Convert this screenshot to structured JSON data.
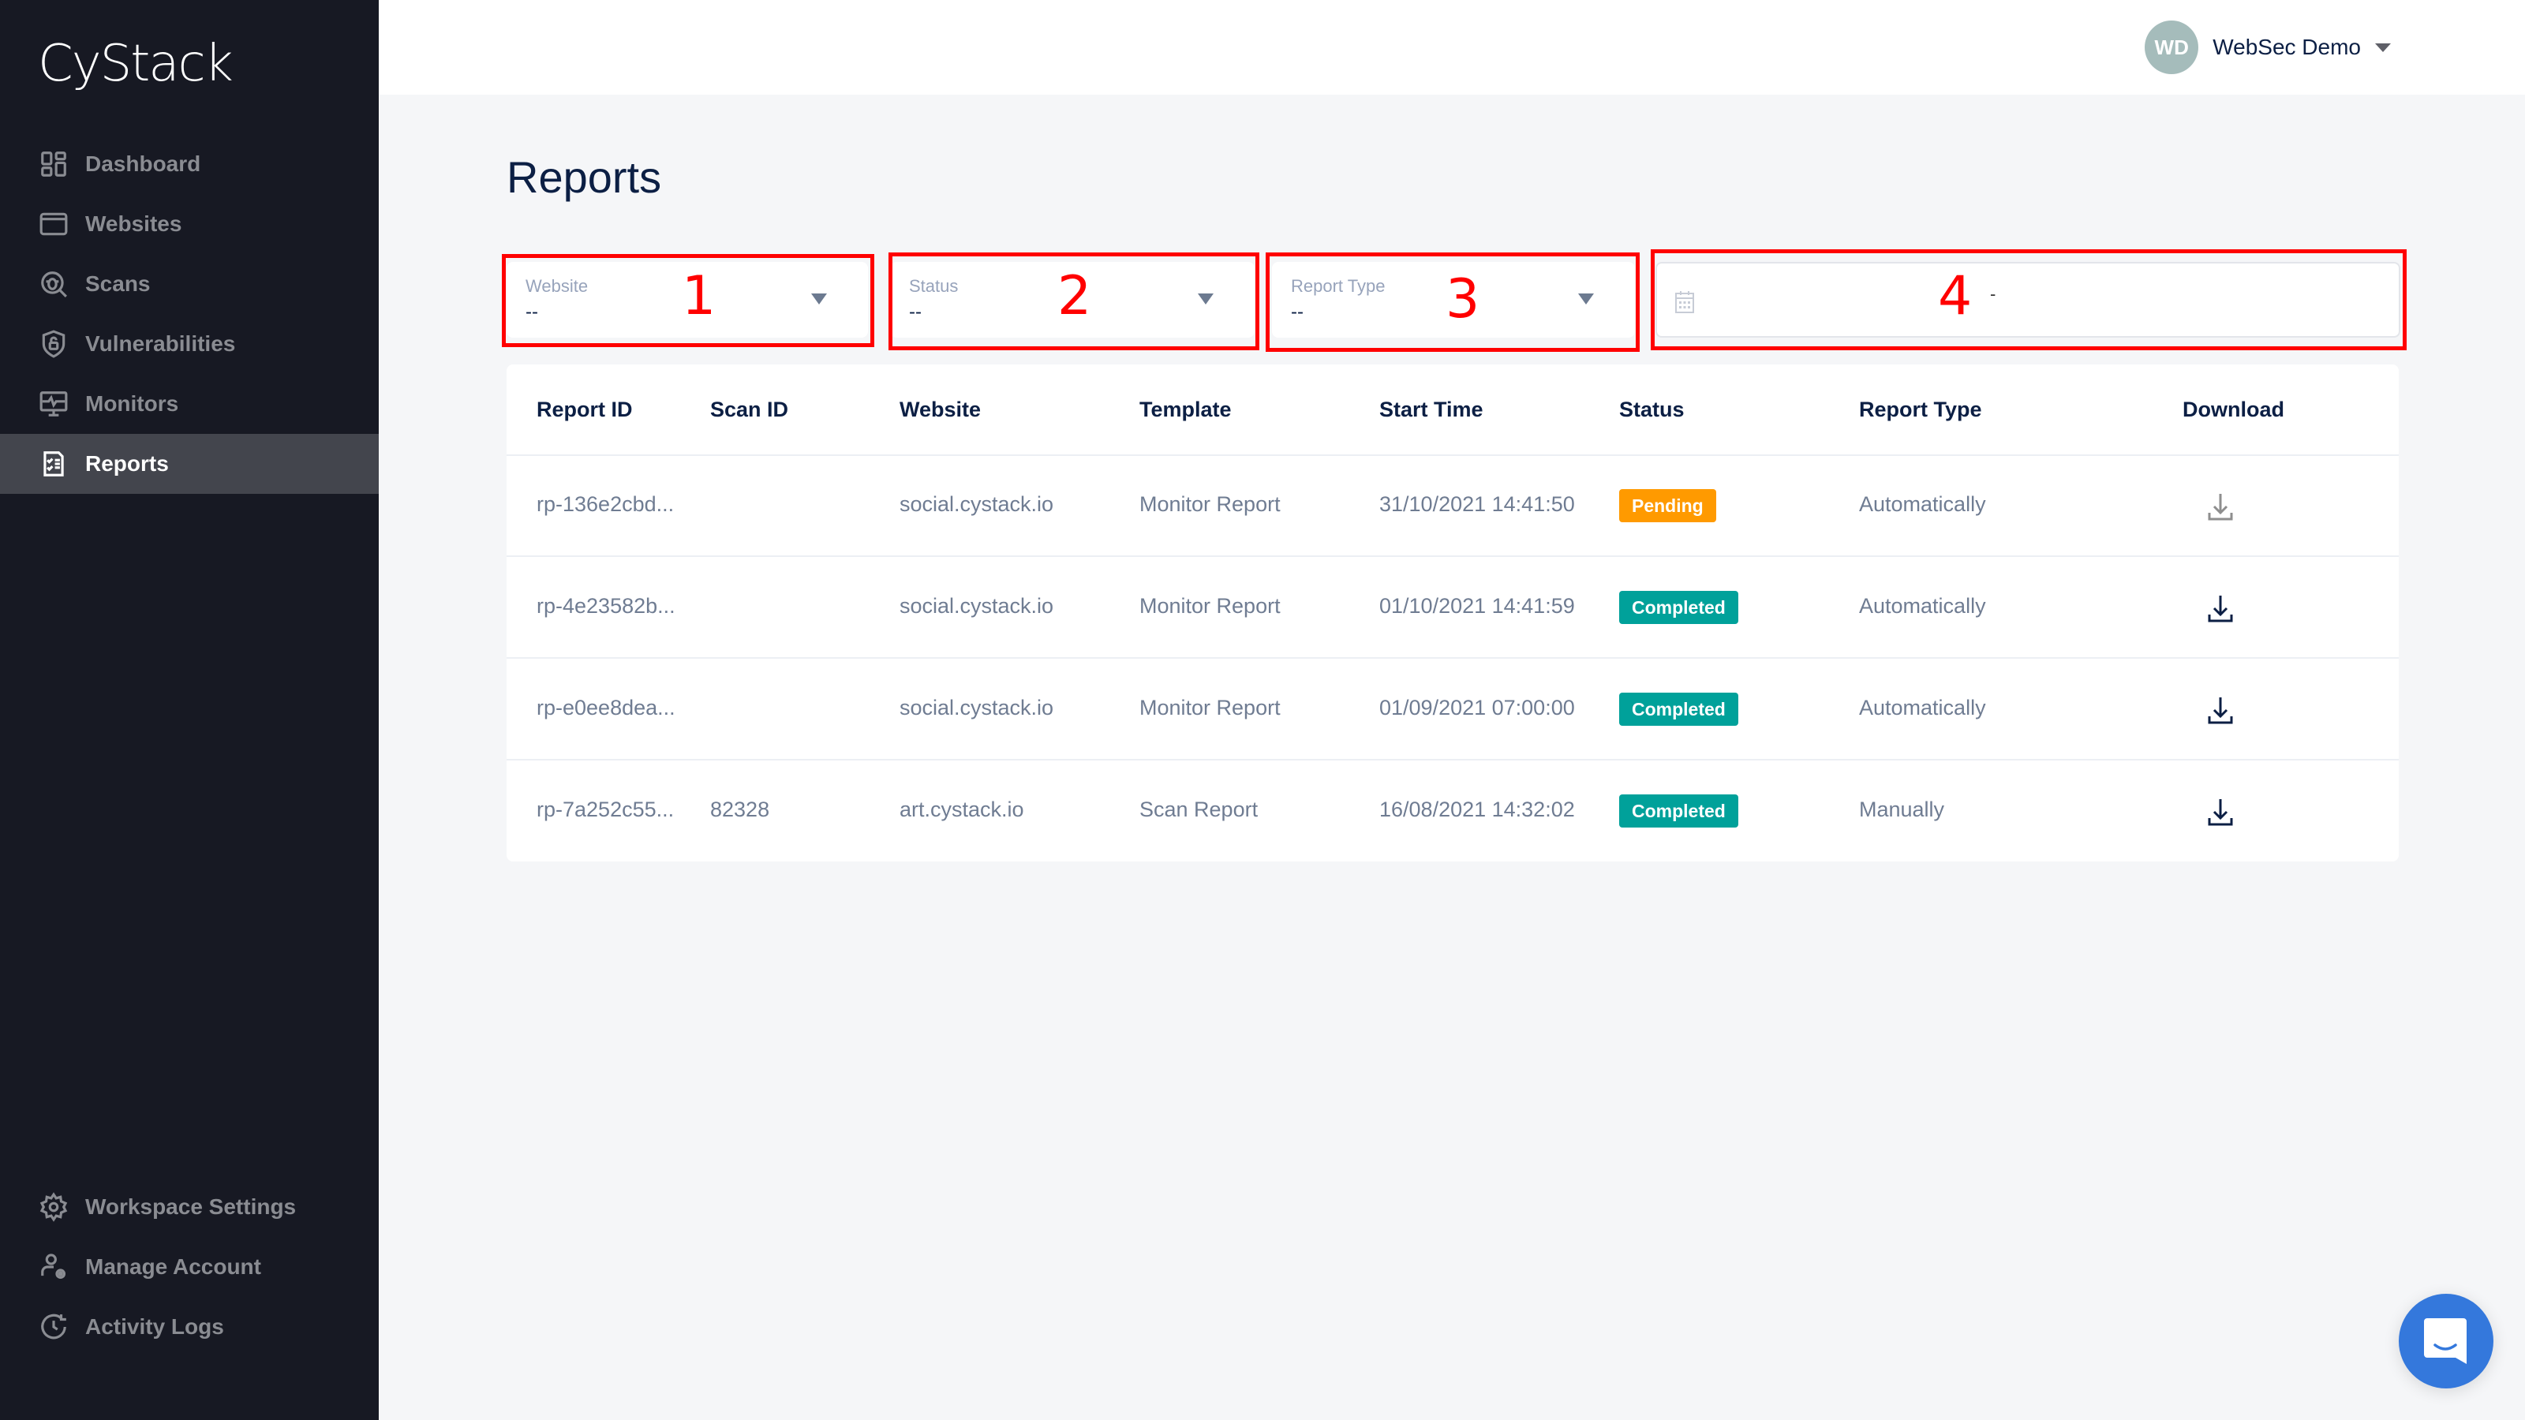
{
  "app": {
    "logo": "CyStack"
  },
  "sidebar": {
    "items": [
      {
        "label": "Dashboard",
        "icon": "dashboard-icon",
        "active": false
      },
      {
        "label": "Websites",
        "icon": "browser-window-icon",
        "active": false
      },
      {
        "label": "Scans",
        "icon": "bug-search-icon",
        "active": false
      },
      {
        "label": "Vulnerabilities",
        "icon": "shield-lock-icon",
        "active": false
      },
      {
        "label": "Monitors",
        "icon": "monitor-pulse-icon",
        "active": false
      },
      {
        "label": "Reports",
        "icon": "report-checklist-icon",
        "active": true
      }
    ],
    "bottom_items": [
      {
        "label": "Workspace Settings",
        "icon": "gear-icon"
      },
      {
        "label": "Manage Account",
        "icon": "user-gear-icon"
      },
      {
        "label": "Activity Logs",
        "icon": "clock-history-icon"
      }
    ]
  },
  "header": {
    "user": {
      "initials": "WD",
      "name": "WebSec Demo"
    }
  },
  "page": {
    "title": "Reports"
  },
  "filters": {
    "website": {
      "label": "Website",
      "value": "--"
    },
    "status": {
      "label": "Status",
      "value": "--"
    },
    "report_type": {
      "label": "Report Type",
      "value": "--"
    },
    "date_range": {
      "separator": "-"
    }
  },
  "annotations": [
    "1",
    "2",
    "3",
    "4"
  ],
  "table": {
    "columns": [
      "Report ID",
      "Scan ID",
      "Website",
      "Template",
      "Start Time",
      "Status",
      "Report Type",
      "Download"
    ],
    "rows": [
      {
        "report_id": "rp-136e2cbd...",
        "scan_id": "",
        "website": "social.cystack.io",
        "template": "Monitor Report",
        "start_time": "31/10/2021 14:41:50",
        "status": "Pending",
        "report_type": "Automatically",
        "download_enabled": false
      },
      {
        "report_id": "rp-4e23582b...",
        "scan_id": "",
        "website": "social.cystack.io",
        "template": "Monitor Report",
        "start_time": "01/10/2021 14:41:59",
        "status": "Completed",
        "report_type": "Automatically",
        "download_enabled": true
      },
      {
        "report_id": "rp-e0ee8dea...",
        "scan_id": "",
        "website": "social.cystack.io",
        "template": "Monitor Report",
        "start_time": "01/09/2021 07:00:00",
        "status": "Completed",
        "report_type": "Automatically",
        "download_enabled": true
      },
      {
        "report_id": "rp-7a252c55...",
        "scan_id": "82328",
        "website": "art.cystack.io",
        "template": "Scan Report",
        "start_time": "16/08/2021 14:32:02",
        "status": "Completed",
        "report_type": "Manually",
        "download_enabled": true
      }
    ]
  },
  "colors": {
    "sidebar_bg": "#171923",
    "active_item_bg": "#43454d",
    "pending": "#ff9a00",
    "completed": "#00a19a",
    "annotation": "#ff0000",
    "chat": "#3478dc"
  }
}
